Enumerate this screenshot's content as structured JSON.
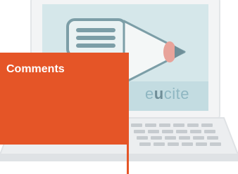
{
  "brand": {
    "prefix": "e",
    "strong": "u",
    "suffix": "cite"
  },
  "card": {
    "label": "Comments"
  },
  "colors": {
    "card_orange": "#e55527",
    "screen_teal": "#cfe3e7",
    "laptop_body": "#f2f3f4"
  },
  "icons": [
    "laptop-icon",
    "document-lines-icon",
    "pencil-icon",
    "keyboard-icon"
  ]
}
